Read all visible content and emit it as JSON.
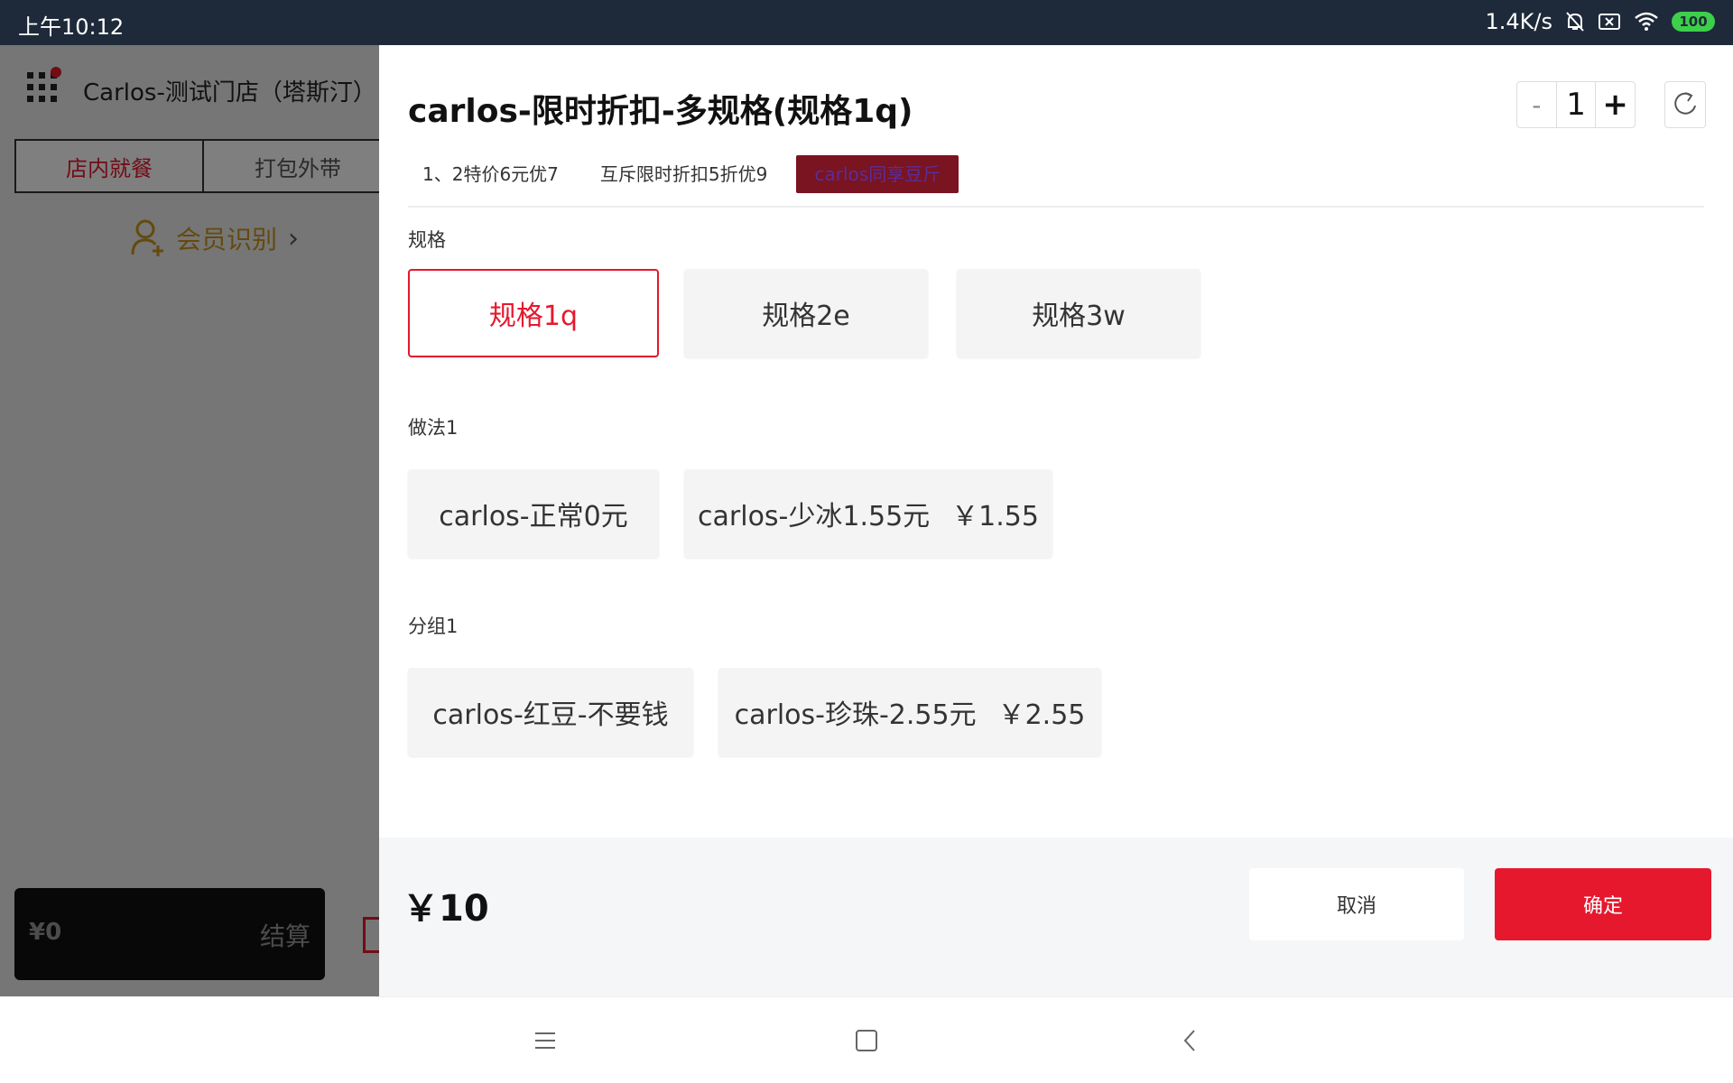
{
  "status_bar": {
    "time": "上午10:12",
    "net_speed": "1.4K/s",
    "battery": "100",
    "icons": [
      "mute-bell-icon",
      "sim-off-icon",
      "wifi-icon",
      "battery-icon"
    ]
  },
  "background_app": {
    "store_name": "Carlos-测试门店（塔斯汀）",
    "tabs": [
      "店内就餐",
      "打包外带"
    ],
    "member_label": "会员识别",
    "cart_amount": "¥0",
    "settle_label": "结算"
  },
  "dialog": {
    "title": "carlos-限时折扣-多规格(规格1q)",
    "quantity": "1",
    "minus_label": "-",
    "plus_label": "+",
    "promotions": [
      "1、2特价6元优7",
      "互斥限时折扣5折优9",
      "carlos同享豆斤"
    ],
    "selected_promotion_index": 2,
    "sections": {
      "spec": {
        "label": "规格",
        "options": [
          "规格1q",
          "规格2e",
          "规格3w"
        ],
        "selected": "规格1q"
      },
      "method": {
        "label": "做法1",
        "options": [
          {
            "name": "carlos-正常0元",
            "price": ""
          },
          {
            "name": "carlos-少冰1.55元",
            "price": "￥1.55"
          }
        ]
      },
      "group": {
        "label": "分组1",
        "options": [
          {
            "name": "carlos-红豆-不要钱",
            "price": ""
          },
          {
            "name": "carlos-珍珠-2.55元",
            "price": "￥2.55"
          }
        ]
      }
    },
    "total": "￥10",
    "cancel_label": "取消",
    "confirm_label": "确定"
  },
  "colors": {
    "accent": "#e5182d",
    "status_bar_bg": "#1e2a3a",
    "promo_active_bg": "#7a1420"
  }
}
